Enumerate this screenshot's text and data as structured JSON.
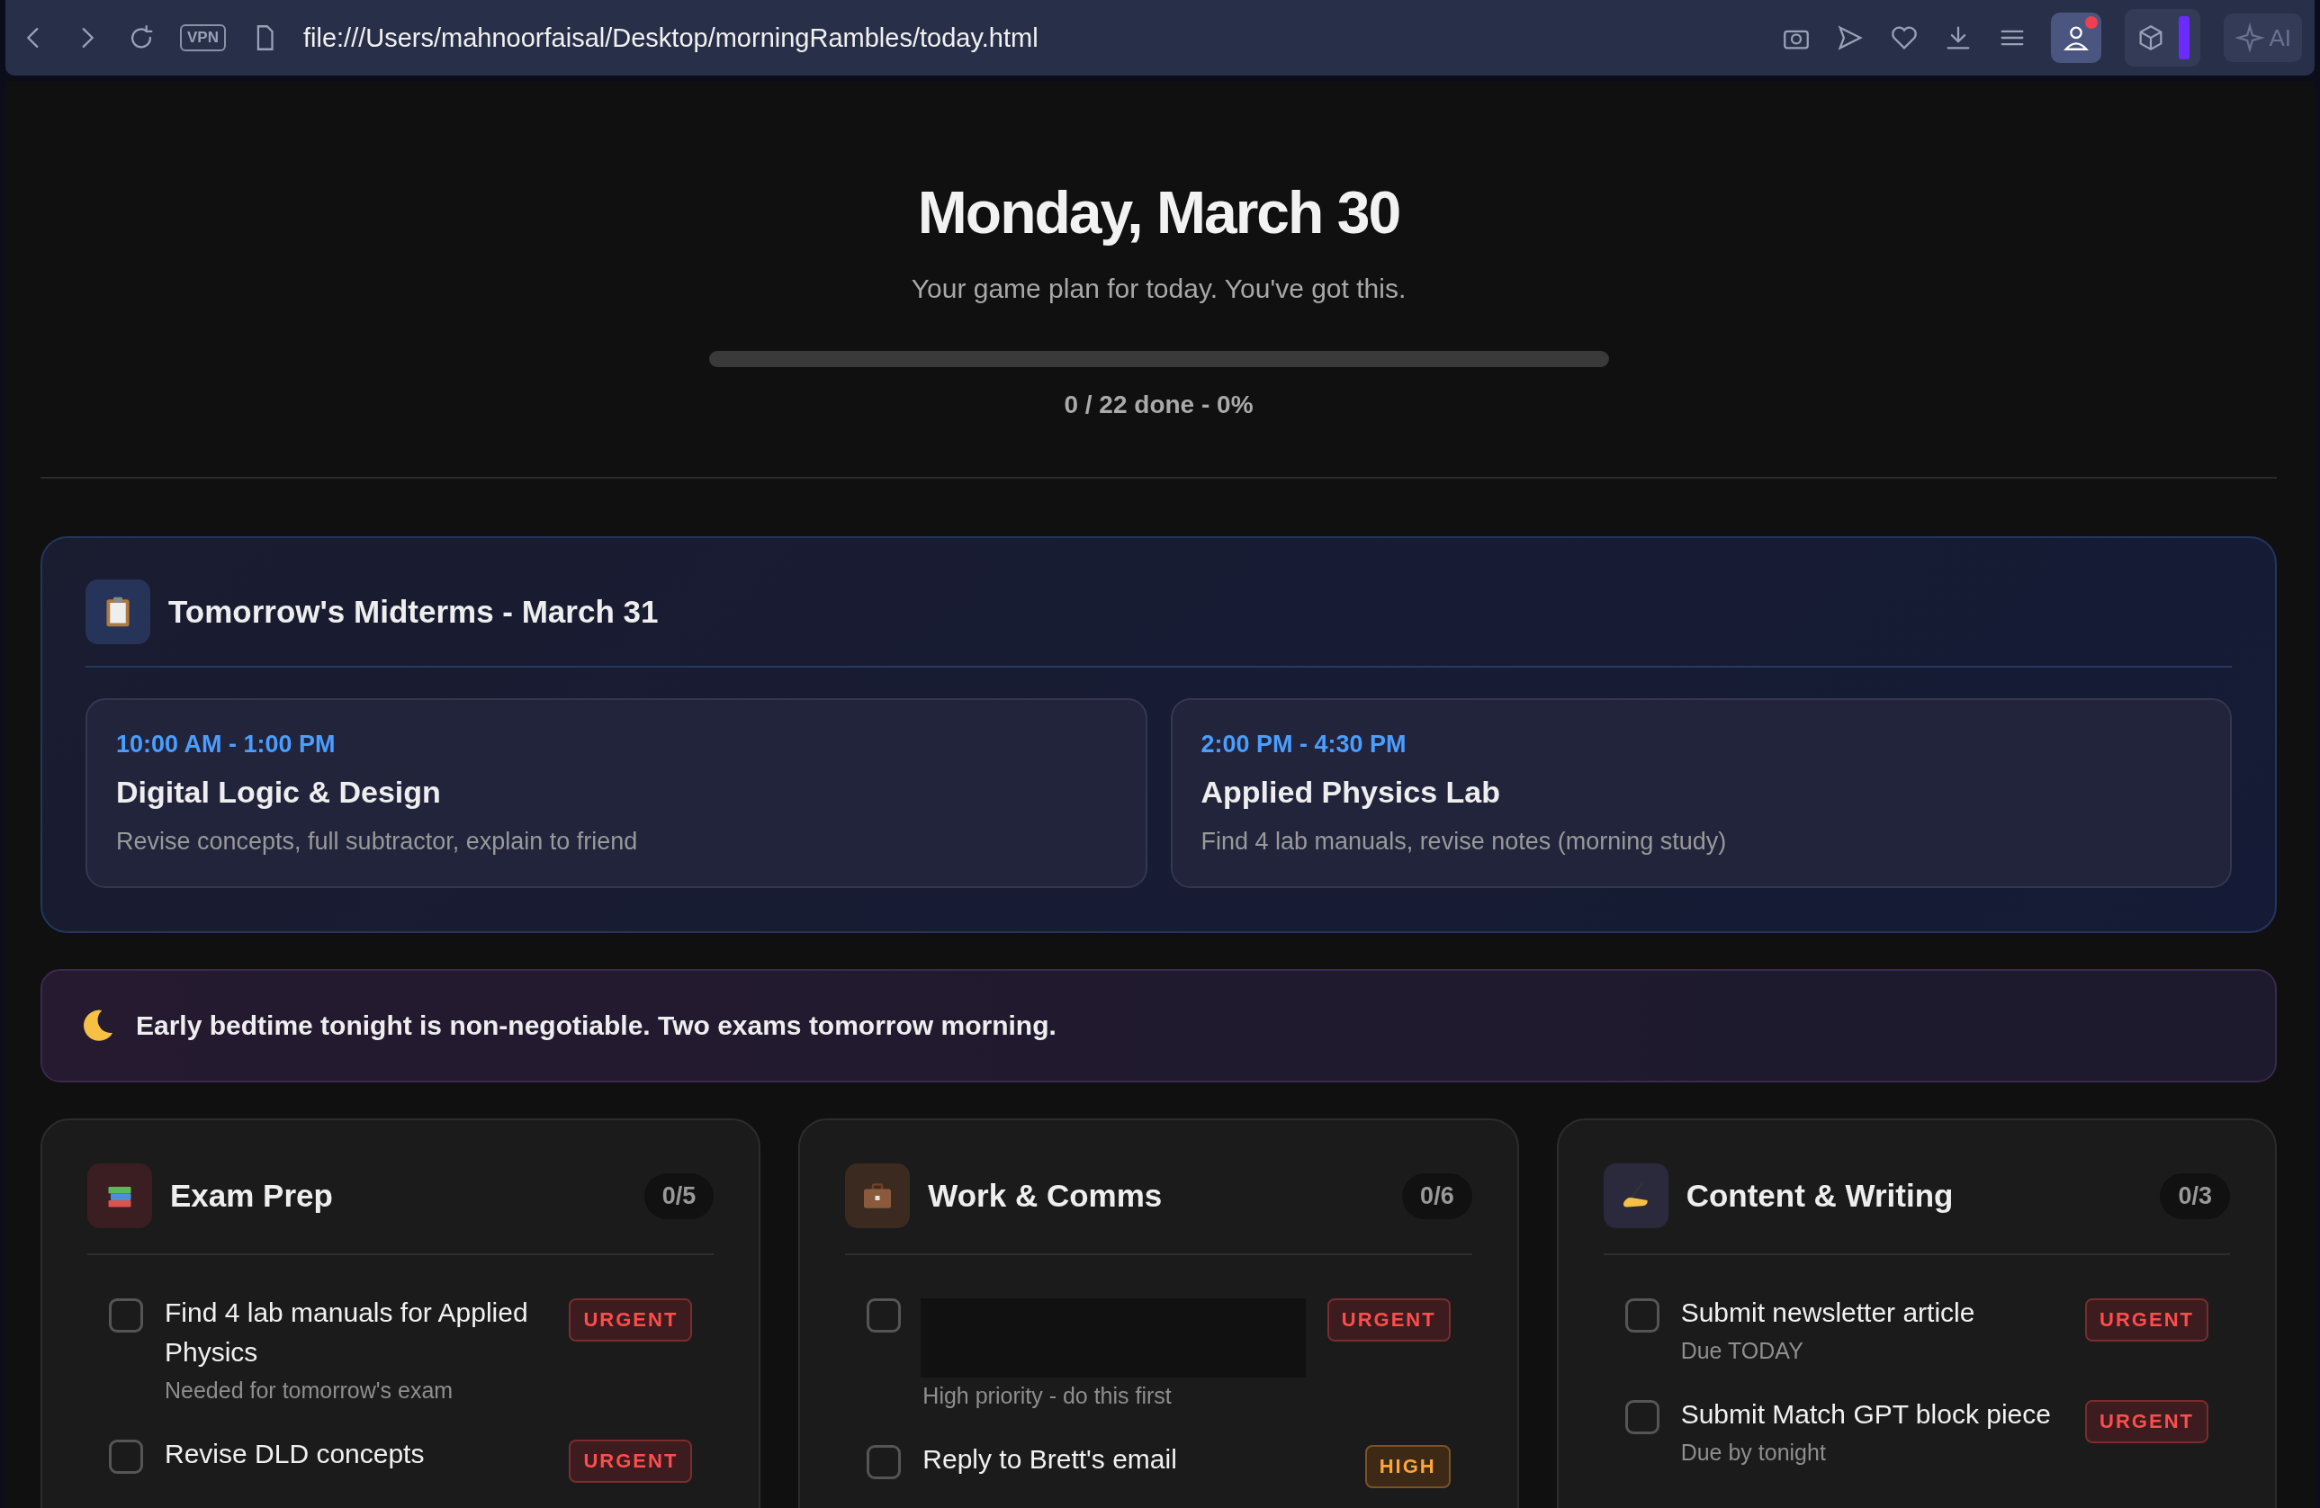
{
  "browser": {
    "url": "file:///Users/mahnoorfaisal/Desktop/morningRambles/today.html",
    "vpn_label": "VPN",
    "ai_label": "AI",
    "profile_notification": true
  },
  "header": {
    "title": "Monday, March 30",
    "subtitle": "Your game plan for today. You've got this.",
    "progress": {
      "level": 0,
      "reading": "0 / 22 done - 0%"
    }
  },
  "midterms": {
    "title": "Tomorrow's Midterms - March 31",
    "exams": [
      {
        "time": "10:00 AM - 1:00 PM",
        "name": "Digital Logic & Design",
        "notes": "Revise concepts, full subtractor, explain to friend"
      },
      {
        "time": "2:00 PM - 4:30 PM",
        "name": "Applied Physics Lab",
        "notes": "Find 4 lab manuals, revise notes (morning study)"
      }
    ]
  },
  "notice": {
    "text": "Early bedtime tonight is non-negotiable. Two exams tomorrow morning."
  },
  "sections": [
    {
      "title": "Exam Prep",
      "kind": "books",
      "count": "0/5",
      "tasks": [
        {
          "kind": "normal",
          "title": "Find 4 lab manuals for Applied Physics",
          "note": "Needed for tomorrow's exam",
          "badge": {
            "kind": "urgent",
            "label": "URGENT"
          },
          "checked": false
        },
        {
          "kind": "normal",
          "title": "Revise DLD concepts",
          "badge": {
            "kind": "urgent",
            "label": "URGENT"
          },
          "checked": false
        }
      ]
    },
    {
      "title": "Work & Comms",
      "kind": "briefcase",
      "count": "0/6",
      "tasks": [
        {
          "kind": "redacted",
          "note": "High priority - do this first",
          "badge": {
            "kind": "urgent",
            "label": "URGENT"
          },
          "checked": false
        },
        {
          "kind": "normal",
          "title": "Reply to Brett's email",
          "badge": {
            "kind": "high",
            "label": "HIGH"
          },
          "checked": false
        }
      ]
    },
    {
      "title": "Content & Writing",
      "kind": "pen",
      "count": "0/3",
      "tasks": [
        {
          "kind": "normal",
          "title": "Submit newsletter article",
          "note": "Due TODAY",
          "badge": {
            "kind": "urgent",
            "label": "URGENT"
          },
          "checked": false
        },
        {
          "kind": "normal",
          "title": "Submit Match GPT block piece",
          "note": "Due by tonight",
          "badge": {
            "kind": "urgent",
            "label": "URGENT"
          },
          "checked": false
        }
      ]
    }
  ]
}
